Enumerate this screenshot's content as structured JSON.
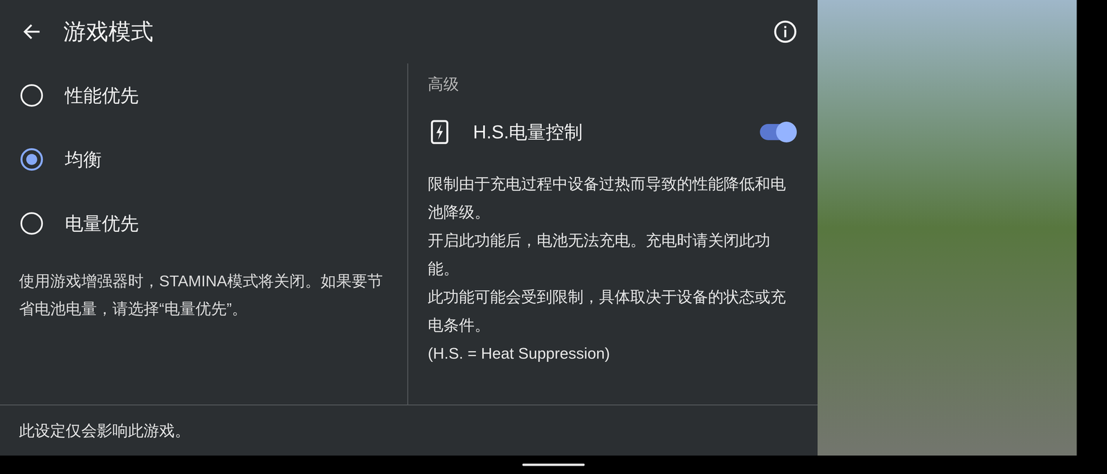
{
  "header": {
    "title": "游戏模式"
  },
  "modes": [
    {
      "label": "性能优先",
      "selected": false
    },
    {
      "label": "均衡",
      "selected": true
    },
    {
      "label": "电量优先",
      "selected": false
    }
  ],
  "mode_note": "使用游戏增强器时，STAMINA模式将关闭。如果要节省电池电量，请选择“电量优先”。",
  "footer": "此设定仅会影响此游戏。",
  "advanced": {
    "heading": "高级",
    "setting": {
      "label": "H.S.电量控制",
      "on": true
    },
    "description": [
      "限制由于充电过程中设备过热而导致的性能降低和电池降级。",
      "开启此功能后，电池无法充电。充电时请关闭此功能。",
      "此功能可能会受到限制，具体取决于设备的状态或充电条件。",
      "(H.S. = Heat Suppression)"
    ]
  }
}
